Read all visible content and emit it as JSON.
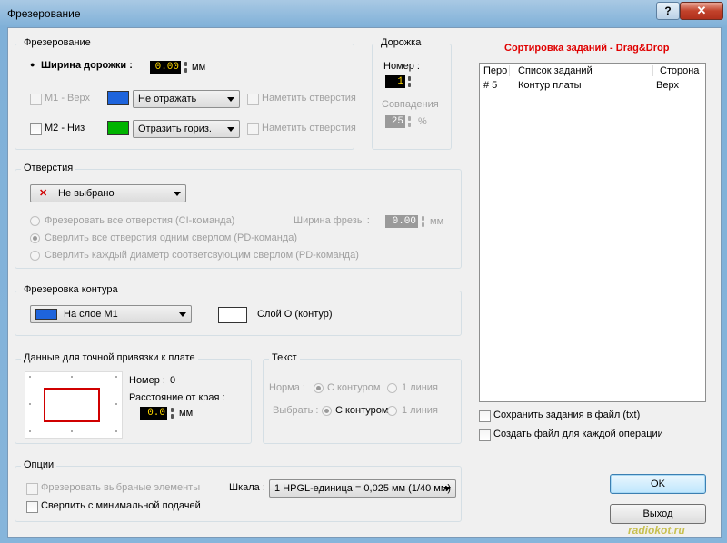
{
  "window": {
    "title": "Фрезерование",
    "help_icon": "?",
    "close_icon": "✕"
  },
  "milling": {
    "legend": "Фрезерование",
    "track_width_label": "Ширина дорожки :",
    "track_width_value": "0.00",
    "track_width_unit": "мм",
    "m1_label": "M1 - Верх",
    "m1_color": "#1e64dc",
    "m1_mode": "Не отражать",
    "m1_mark_holes": "Наметить отверстия",
    "m2_label": "M2 - Низ",
    "m2_color": "#00b400",
    "m2_mode": "Отразить гориз.",
    "m2_mark_holes": "Наметить отверстия"
  },
  "track": {
    "legend": "Дорожка",
    "number_label": "Номер :",
    "number_value": "1",
    "match_label": "Совпадения",
    "match_value": "25",
    "match_unit": "%"
  },
  "holes": {
    "legend": "Отверстия",
    "select_value": "Не выбрано",
    "select_icon": "✕",
    "option1": "Фрезеровать все отверстия (CI-команда)",
    "option2": "Сверлить все отверстия одним сверлом (PD-команда)",
    "option3": "Сверлить каждый диаметр соответсвующим сверлом (PD-команда)",
    "cutter_width_label": "Ширина фрезы :",
    "cutter_width_value": "0.00",
    "cutter_width_unit": "мм"
  },
  "contour": {
    "legend": "Фрезеровка контура",
    "layer_select": "На слое  M1",
    "layer_color": "#1e64dc",
    "layer_label": "Слой O (контур)"
  },
  "binding": {
    "legend": "Данные для точной привязки к плате",
    "number_label": "Номер :",
    "number_value": "0",
    "edge_distance_label": "Расстояние от края :",
    "edge_distance_value": "0.0",
    "edge_distance_unit": "мм"
  },
  "text": {
    "legend": "Текст",
    "norm_label": "Норма :",
    "select_label": "Выбрать :",
    "with_contour": "С контуром",
    "one_line": "1 линия"
  },
  "options": {
    "legend": "Опции",
    "mill_selected": "Фрезеровать выбраные элементы",
    "drill_min_feed": "Сверлить с минимальной подачей",
    "scale_label": "Шкала :",
    "scale_value": "1 HPGL-единица = 0,025 мм (1/40 мм)"
  },
  "sorting": {
    "title": "Сортировка заданий - Drag&Drop",
    "columns": [
      "Перо",
      "Список заданий",
      "Сторона"
    ],
    "rows": [
      {
        "pen": "# 5",
        "task": "Контур платы",
        "side": "Верх"
      }
    ]
  },
  "save_to_file": "Сохранить задания в файл (txt)",
  "create_file_each": "Создать файл для каждой операции",
  "ok_button": "OK",
  "exit_button": "Выход",
  "watermark": "radiokot.ru"
}
